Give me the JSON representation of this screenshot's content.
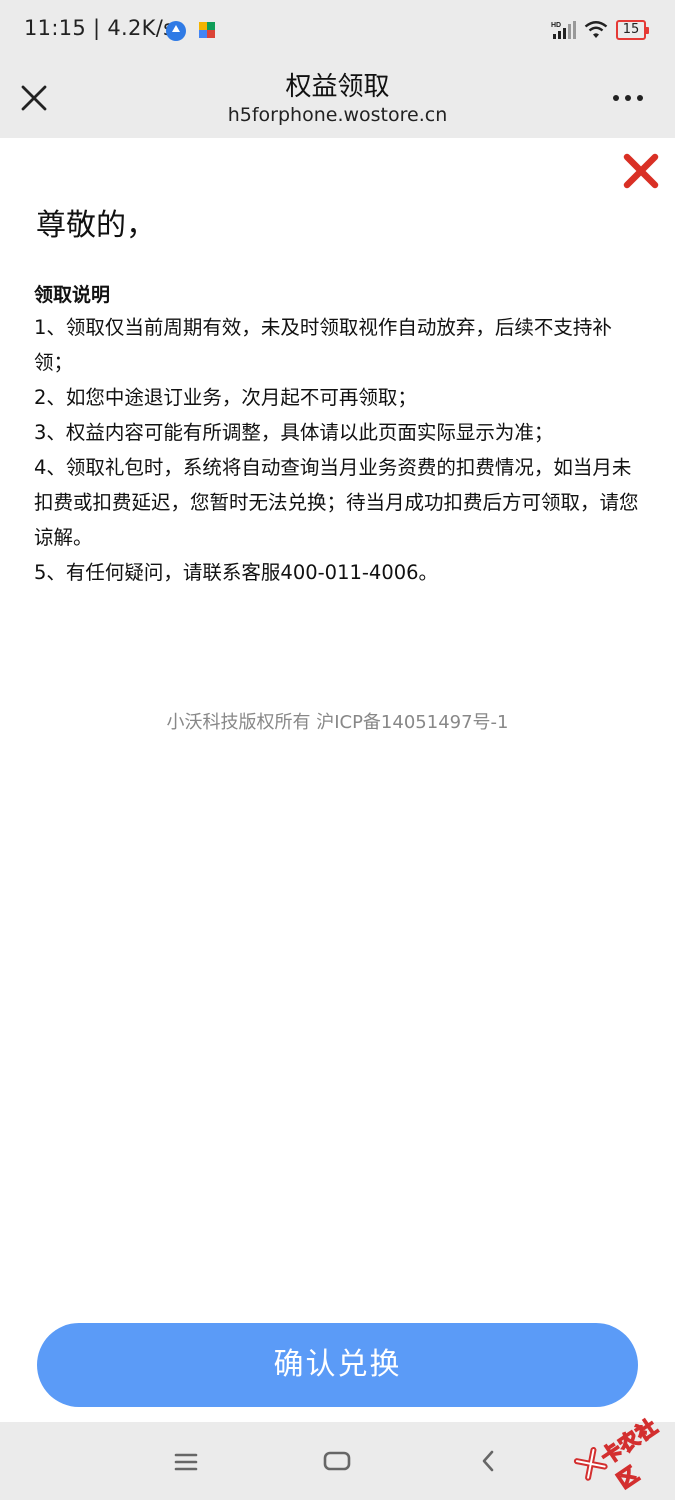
{
  "status_bar": {
    "time_speed": "11:15 | 4.2K/s",
    "battery": "15"
  },
  "nav": {
    "title": "权益领取",
    "url": "h5forphone.wostore.cn"
  },
  "page": {
    "greeting": "尊敬的，",
    "notes_title": "领取说明",
    "notes": [
      "1、领取仅当前周期有效，未及时领取视作自动放弃，后续不支持补领；",
      "2、如您中途退订业务，次月起不可再领取；",
      "3、权益内容可能有所调整，具体请以此页面实际显示为准；",
      "4、领取礼包时，系统将自动查询当月业务资费的扣费情况，如当月未扣费或扣费延迟，您暂时无法兑换；待当月成功扣费后方可领取，请您谅解。",
      "5、有任何疑问，请联系客服400-011-4006。"
    ],
    "footer": "小沃科技版权所有  沪ICP备14051497号-1",
    "confirm_label": "确认兑换"
  },
  "watermark": {
    "text": "卡农社区"
  },
  "colors": {
    "accent_button": "#5b9bf7",
    "close_red": "#d93025",
    "bar_background": "#ebebeb"
  },
  "icons": {
    "nav_close": "close-icon",
    "nav_more": "more-icon",
    "content_close": "red-close-icon",
    "sys_menu": "menu-icon",
    "sys_home": "home-icon",
    "sys_back": "back-icon"
  }
}
